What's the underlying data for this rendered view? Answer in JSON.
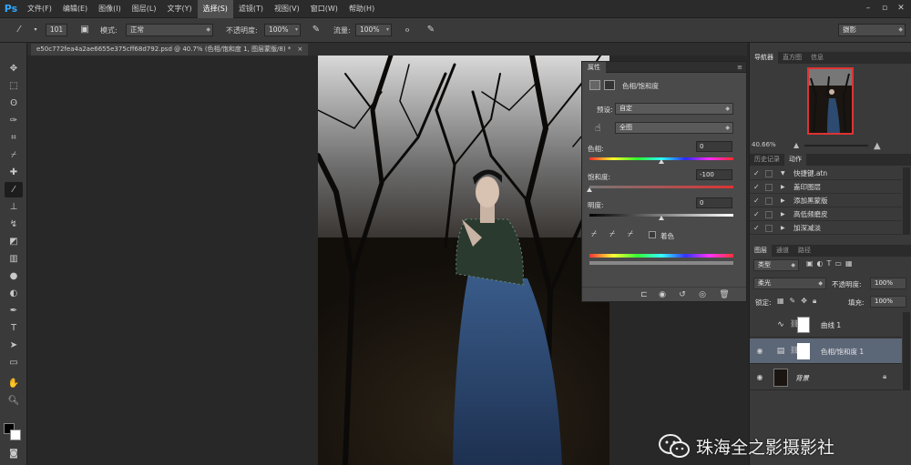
{
  "menubar": {
    "logo": "Ps",
    "items": [
      "文件(F)",
      "编辑(E)",
      "图像(I)",
      "图层(L)",
      "文字(Y)",
      "选择(S)",
      "滤镜(T)",
      "视图(V)",
      "窗口(W)",
      "帮助(H)"
    ],
    "active_index": 5
  },
  "options": {
    "brush_size": "101",
    "mode_label": "模式:",
    "mode_value": "正常",
    "opacity_label": "不透明度:",
    "opacity_value": "100%",
    "flow_label": "流量:",
    "flow_value": "100%",
    "workspace": "摄影"
  },
  "document": {
    "tab_title": "e50c772fea4a2ae6655e375cff68d792.psd @ 40.7% (色相/饱和度 1, 图层蒙版/8) *",
    "close": "×"
  },
  "properties": {
    "tab": "属性",
    "header": "色相/饱和度",
    "preset_label": "预设:",
    "preset_value": "自定",
    "channel_value": "全图",
    "hue_label": "色相:",
    "hue_value": "0",
    "hue": 0,
    "saturation_label": "饱和度:",
    "saturation_value": "-100",
    "saturation": -100,
    "lightness_label": "明度:",
    "lightness_value": "0",
    "lightness": 0,
    "colorize_label": "着色"
  },
  "navigator": {
    "tabs": [
      "导航器",
      "直方图",
      "信息"
    ],
    "zoom": "40.66%"
  },
  "history": {
    "tabs": [
      "历史记录",
      "动作"
    ],
    "rows": [
      {
        "label": "快捷键.atn",
        "type": "folder"
      },
      {
        "label": "盖印图层",
        "type": "action"
      },
      {
        "label": "添加黑蒙版",
        "type": "action"
      },
      {
        "label": "高低频磨皮",
        "type": "action"
      },
      {
        "label": "加深减淡",
        "type": "action"
      }
    ]
  },
  "layers": {
    "tabs": [
      "图层",
      "通道",
      "路径"
    ],
    "filter_value": "类型",
    "blend_value": "柔光",
    "opacity_label": "不透明度:",
    "opacity_value": "100%",
    "lock_label": "锁定:",
    "fill_label": "填充:",
    "fill_value": "100%",
    "items": [
      {
        "name": "曲线 1",
        "visible": false,
        "selected": false
      },
      {
        "name": "色相/饱和度 1",
        "visible": true,
        "selected": true
      },
      {
        "name": "背景",
        "visible": true,
        "selected": false
      }
    ]
  },
  "watermark": {
    "text": "珠海全之影摄影社"
  },
  "colors": {
    "accent": "#31a8ff",
    "selected_layer": "#5b6677"
  }
}
